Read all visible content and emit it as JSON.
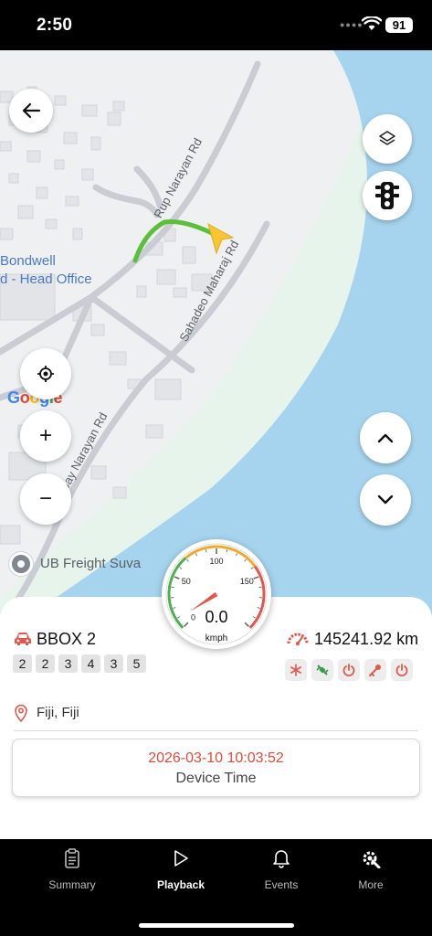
{
  "status_bar": {
    "time": "2:50",
    "battery": "91",
    "signal_icon": "signal-dots-icon",
    "wifi_icon": "wifi-icon"
  },
  "map": {
    "office_label_line1": "Bondwell",
    "office_label_line2": "d - Head Office",
    "roads": [
      "Rup Narayan Rd",
      "Sahadeo Maharaj Rd",
      "Jay Narayan Rd"
    ],
    "google_logo": [
      "G",
      "o",
      "o",
      "g",
      "l",
      "e"
    ],
    "google_colors": [
      "#4285F4",
      "#EA4335",
      "#FBBC05",
      "#4285F4",
      "#34A853",
      "#EA4335"
    ],
    "poi_label": "UB Freight Suva",
    "water_color": "#a6d4ee",
    "park_color": "#e6f4ec",
    "route_color": "#5cbf3a",
    "vehicle_marker_color": "#f7c632",
    "buttons": {
      "back": "back-arrow-icon",
      "layers": "layers-icon",
      "traffic": "traffic-light-icon",
      "locate": "locate-icon",
      "zoom_in": "+",
      "zoom_out": "−",
      "scroll_up": "chevron-up-icon",
      "scroll_down": "chevron-down-icon"
    }
  },
  "speedometer": {
    "ticks": [
      "0",
      "50",
      "100",
      "150"
    ],
    "value": "0.0",
    "unit": "kmph",
    "speed": 0,
    "max": 200
  },
  "vehicle": {
    "name": "BBOX 2",
    "plate": [
      "2",
      "2",
      "3",
      "4",
      "3",
      "5"
    ],
    "odometer": "145241.92 km",
    "status_icons": [
      "snowflake-icon",
      "satellite-icon",
      "power-icon",
      "key-icon",
      "power-icon"
    ],
    "accent_color": "#e2574c",
    "location": "Fiji, Fiji",
    "device_time": "2026-03-10 10:03:52",
    "device_time_label": "Device Time"
  },
  "nav": [
    {
      "label": "Summary",
      "icon": "clipboard-icon",
      "active": false
    },
    {
      "label": "Playback",
      "icon": "play-icon",
      "active": true
    },
    {
      "label": "Events",
      "icon": "bell-icon",
      "active": false
    },
    {
      "label": "More",
      "icon": "gear-wrench-icon",
      "active": false
    }
  ]
}
